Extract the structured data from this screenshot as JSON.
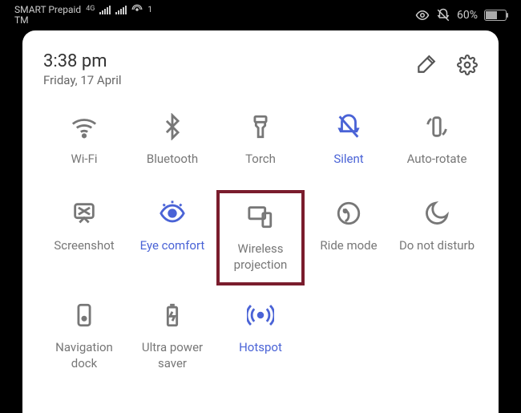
{
  "status": {
    "carrier1": "SMART Prepaid",
    "carrier2": "TM",
    "net_badge": "4G",
    "hotspot_clients": "1",
    "battery_percent": "60%"
  },
  "header": {
    "time": "3:38 pm",
    "date": "Friday, 17 April"
  },
  "tiles": {
    "wifi": "Wi-Fi",
    "bluetooth": "Bluetooth",
    "torch": "Torch",
    "silent": "Silent",
    "autorotate": "Auto-rotate",
    "screenshot": "Screenshot",
    "eyecomfort": "Eye comfort",
    "wireless": "Wireless projection",
    "ridemode": "Ride mode",
    "dnd": "Do not disturb",
    "navdock": "Navigation dock",
    "ultrapower": "Ultra power saver",
    "hotspot": "Hotspot"
  }
}
